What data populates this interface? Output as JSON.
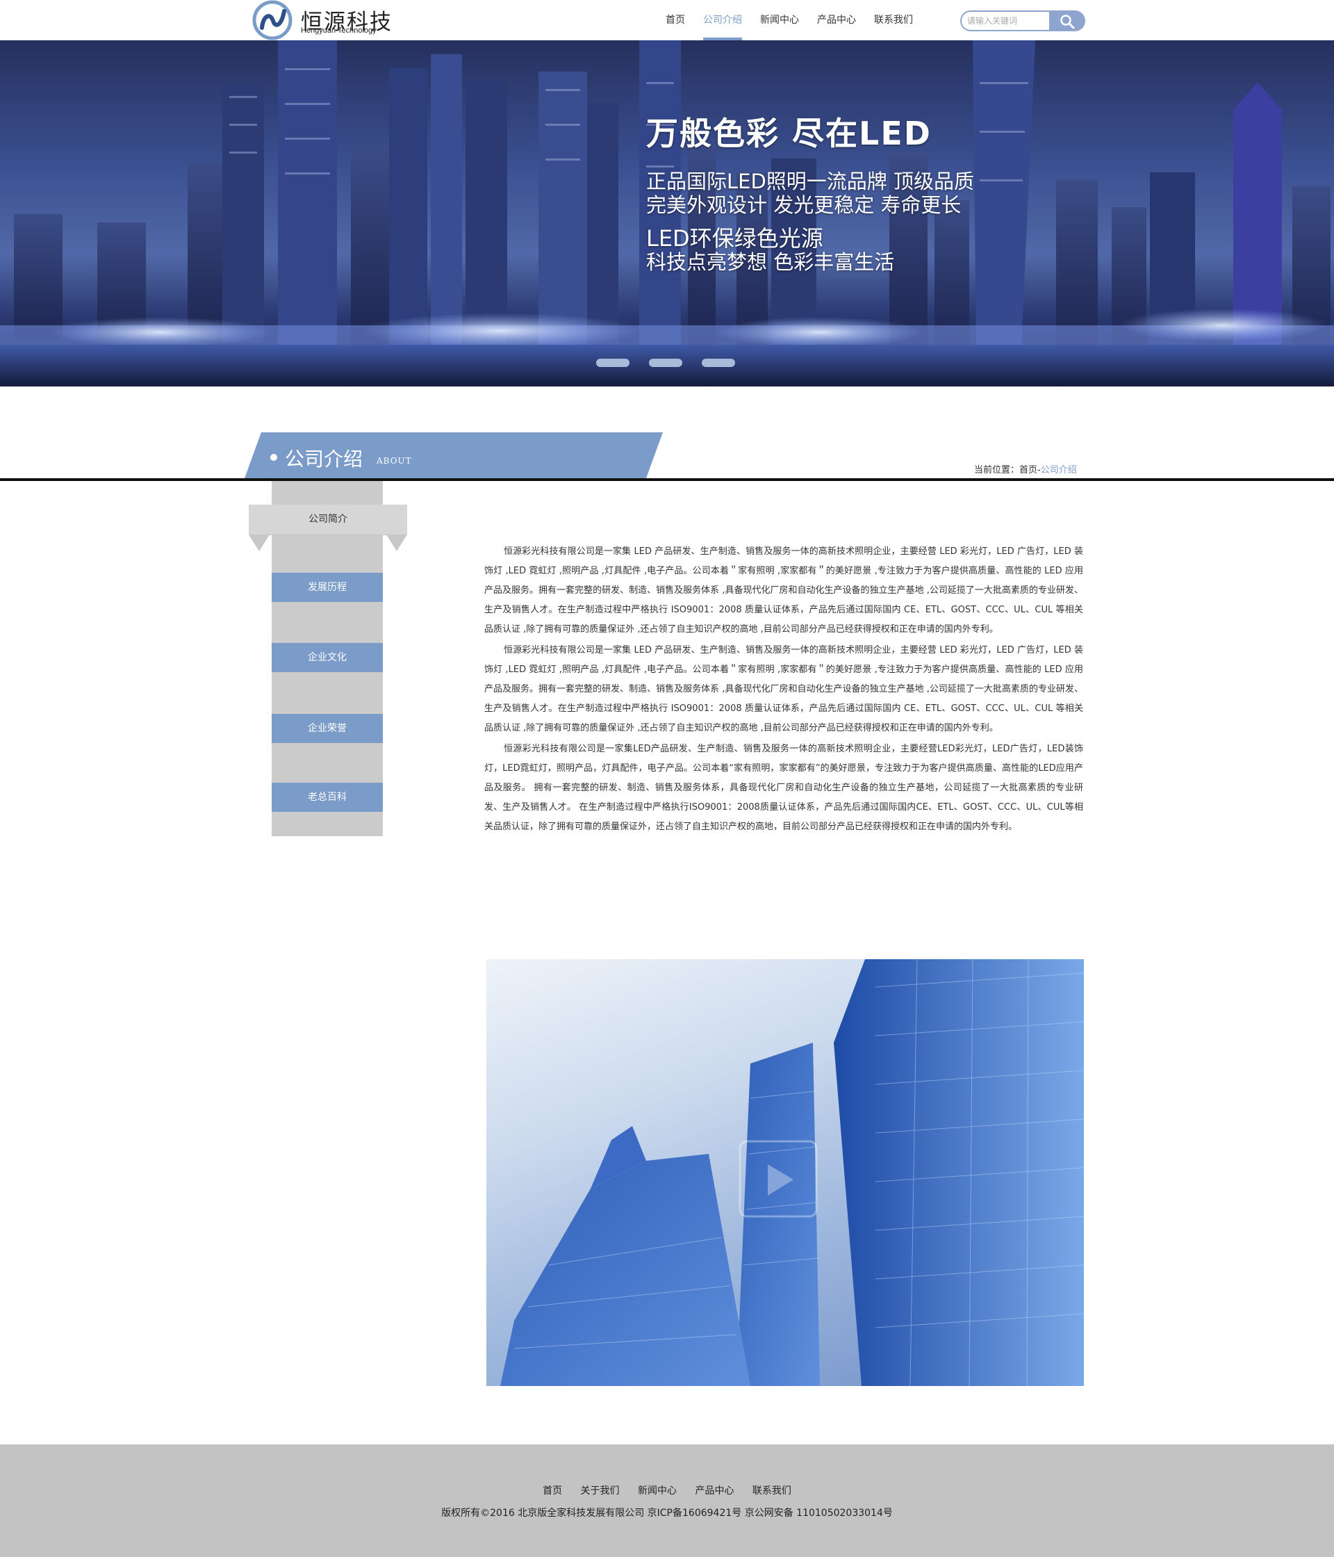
{
  "brand": {
    "name_cn": "恒源科技",
    "name_en": "Hengyuan Technology",
    "accent_color": "#7b9cc8"
  },
  "nav": {
    "items": [
      {
        "label": "首页"
      },
      {
        "label": "公司介绍"
      },
      {
        "label": "新闻中心"
      },
      {
        "label": "产品中心"
      },
      {
        "label": "联系我们"
      }
    ],
    "active_index": 1
  },
  "search": {
    "placeholder": "请输入关键词",
    "icon": "search-icon"
  },
  "banner": {
    "title": "万般色彩 尽在LED",
    "lines": [
      "正品国际LED照明一流品牌 顶级品质",
      "完美外观设计 发光更稳定 寿命更长",
      "LED环保绿色光源",
      "科技点亮梦想 色彩丰富生活"
    ],
    "slide_count": 3
  },
  "section": {
    "title": "公司介绍",
    "subtitle": "ABOUT",
    "breadcrumb_prefix": "当前位置：",
    "breadcrumb_home": "首页",
    "breadcrumb_sep": "-",
    "breadcrumb_current": "公司介绍"
  },
  "sidebar": {
    "top": "公司简介",
    "items": [
      {
        "label": "发展历程"
      },
      {
        "label": "企业文化"
      },
      {
        "label": "企业荣誉"
      },
      {
        "label": "老总百科"
      }
    ]
  },
  "article": {
    "paragraphs": [
      "恒源彩光科技有限公司是一家集 LED 产品研发、生产制造、销售及服务一体的高新技术照明企业，主要经营 LED 彩光灯，LED 广告灯，LED 装饰灯 ,LED 霓虹灯 ,照明产品 ,灯具配件 ,电子产品。公司本着＂家有照明 ,家家都有＂的美好愿景 ,专注致力于为客户提供高质量、高性能的 LED 应用产品及服务。拥有一套完整的研发、制造、销售及服务体系 ,具备现代化厂房和自动化生产设备的独立生产基地 ,公司延揽了一大批高素质的专业研发、生产及销售人才。在生产制造过程中严格执行 ISO9001：2008 质量认证体系，产品先后通过国际国内 CE、ETL、GOST、CCC、UL、CUL 等相关品质认证 ,除了拥有可靠的质量保证外 ,还占领了自主知识产权的高地 ,目前公司部分产品已经获得授权和正在申请的国内外专利。",
      "恒源彩光科技有限公司是一家集 LED 产品研发、生产制造、销售及服务一体的高新技术照明企业，主要经营 LED 彩光灯，LED 广告灯，LED 装饰灯 ,LED 霓虹灯 ,照明产品 ,灯具配件 ,电子产品。公司本着＂家有照明 ,家家都有＂的美好愿景 ,专注致力于为客户提供高质量、高性能的 LED 应用产品及服务。拥有一套完整的研发、制造、销售及服务体系 ,具备现代化厂房和自动化生产设备的独立生产基地 ,公司延揽了一大批高素质的专业研发、生产及销售人才。在生产制造过程中严格执行 ISO9001：2008 质量认证体系，产品先后通过国际国内 CE、ETL、GOST、CCC、UL、CUL 等相关品质认证 ,除了拥有可靠的质量保证外 ,还占领了自主知识产权的高地 ,目前公司部分产品已经获得授权和正在申请的国内外专利。",
      "恒源彩光科技有限公司是一家集LED产品研发、生产制造、销售及服务一体的高新技术照明企业，主要经营LED彩光灯，LED广告灯，LED装饰灯，LED霓虹灯，照明产品，灯具配件，电子产品。公司本着“家有照明，家家都有”的美好愿景，专注致力于为客户提供高质量、高性能的LED应用产品及服务。 拥有一套完整的研发、制造、销售及服务体系，具备现代化厂房和自动化生产设备的独立生产基地，公司延揽了一大批高素质的专业研发、生产及销售人才。 在生产制造过程中严格执行ISO9001：2008质量认证体系，产品先后通过国际国内CE、ETL、GOST、CCC、UL、CUL等相关品质认证，除了拥有可靠的质量保证外，还占领了自主知识产权的高地，目前公司部分产品已经获得授权和正在申请的国内外专利。"
    ]
  },
  "footer": {
    "links": [
      {
        "label": "首页"
      },
      {
        "label": "关于我们"
      },
      {
        "label": "新闻中心"
      },
      {
        "label": "产品中心"
      },
      {
        "label": "联系我们"
      }
    ],
    "copyright": "版权所有©2016  北京版全家科技发展有限公司  京ICP备16069421号   京公网安备  11010502033014号"
  }
}
